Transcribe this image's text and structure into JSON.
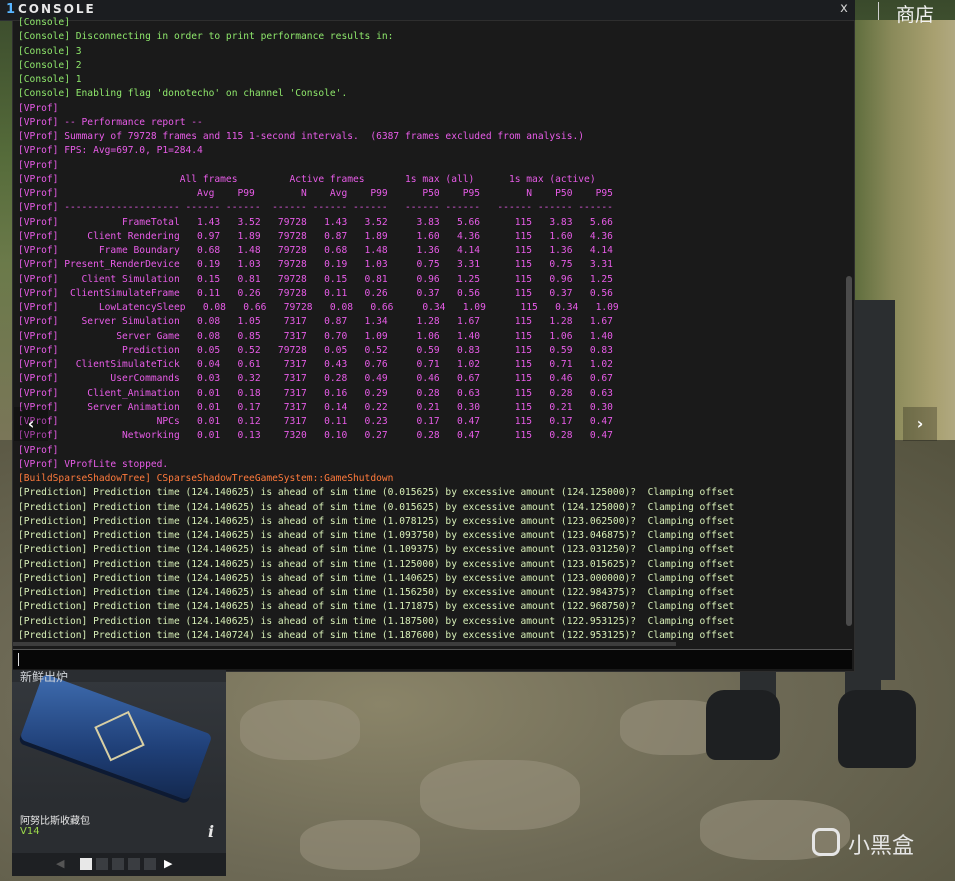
{
  "header": {
    "logo_glyph": "1",
    "title": "CONSOLE",
    "close_label": "x",
    "shop_label": "商店"
  },
  "colors": {
    "console": "#8fe86c",
    "vprof": "#e85ce8",
    "build": "#ff7a3c",
    "prediction": "#d8f0b8"
  },
  "console": {
    "lines": [
      {
        "kind": "console",
        "text": "[Console] "
      },
      {
        "kind": "console",
        "text": "[Console] Disconnecting in order to print performance results in:"
      },
      {
        "kind": "console",
        "text": "[Console] 3"
      },
      {
        "kind": "console",
        "text": "[Console] 2"
      },
      {
        "kind": "console",
        "text": "[Console] 1"
      },
      {
        "kind": "console",
        "text": "[Console] Enabling flag 'donotecho' on channel 'Console'."
      },
      {
        "kind": "vprof",
        "text": "[VProf]"
      },
      {
        "kind": "vprof",
        "text": "[VProf] -- Performance report --"
      },
      {
        "kind": "vprof",
        "text": "[VProf] Summary of 79728 frames and 115 1-second intervals.  (6387 frames excluded from analysis.)"
      },
      {
        "kind": "vprof",
        "text": "[VProf] FPS: Avg=697.0, P1=284.4"
      },
      {
        "kind": "vprof",
        "text": "[VProf]"
      },
      {
        "kind": "vprof",
        "text": "[VProf]                     All frames         Active frames       1s max (all)      1s max (active)"
      },
      {
        "kind": "vprof",
        "text": "[VProf]                        Avg    P99        N    Avg    P99      P50    P95        N    P50    P95"
      },
      {
        "kind": "vprof",
        "text": "[VProf] -------------------- ------ ------  ------ ------ ------   ------ ------   ------ ------ ------"
      },
      {
        "kind": "vprof",
        "text": "[VProf]           FrameTotal   1.43   3.52   79728   1.43   3.52     3.83   5.66      115   3.83   5.66"
      },
      {
        "kind": "vprof",
        "text": "[VProf]     Client Rendering   0.97   1.89   79728   0.87   1.89     1.60   4.36      115   1.60   4.36"
      },
      {
        "kind": "vprof",
        "text": "[VProf]       Frame Boundary   0.68   1.48   79728   0.68   1.48     1.36   4.14      115   1.36   4.14"
      },
      {
        "kind": "vprof",
        "text": "[VProf] Present_RenderDevice   0.19   1.03   79728   0.19   1.03     0.75   3.31      115   0.75   3.31"
      },
      {
        "kind": "vprof",
        "text": "[VProf]    Client Simulation   0.15   0.81   79728   0.15   0.81     0.96   1.25      115   0.96   1.25"
      },
      {
        "kind": "vprof",
        "text": "[VProf]  ClientSimulateFrame   0.11   0.26   79728   0.11   0.26     0.37   0.56      115   0.37   0.56"
      },
      {
        "kind": "vprof",
        "text": "[VProf]       LowLatencySleep   0.08   0.66   79728   0.08   0.66     0.34   1.09      115   0.34   1.09"
      },
      {
        "kind": "vprof",
        "text": "[VProf]    Server Simulation   0.08   1.05    7317   0.87   1.34     1.28   1.67      115   1.28   1.67"
      },
      {
        "kind": "vprof",
        "text": "[VProf]          Server Game   0.08   0.85    7317   0.70   1.09     1.06   1.40      115   1.06   1.40"
      },
      {
        "kind": "vprof",
        "text": "[VProf]           Prediction   0.05   0.52   79728   0.05   0.52     0.59   0.83      115   0.59   0.83"
      },
      {
        "kind": "vprof",
        "text": "[VProf]   ClientSimulateTick   0.04   0.61    7317   0.43   0.76     0.71   1.02      115   0.71   1.02"
      },
      {
        "kind": "vprof",
        "text": "[VProf]         UserCommands   0.03   0.32    7317   0.28   0.49     0.46   0.67      115   0.46   0.67"
      },
      {
        "kind": "vprof",
        "text": "[VProf]     Client_Animation   0.01   0.18    7317   0.16   0.29     0.28   0.63      115   0.28   0.63"
      },
      {
        "kind": "vprof",
        "text": "[VProf]     Server Animation   0.01   0.17    7317   0.14   0.22     0.21   0.30      115   0.21   0.30"
      },
      {
        "kind": "vprof",
        "text": "[VProf]                 NPCs   0.01   0.12    7317   0.11   0.23     0.17   0.47      115   0.17   0.47"
      },
      {
        "kind": "vprof",
        "text": "[VProf]           Networking   0.01   0.13    7320   0.10   0.27     0.28   0.47      115   0.28   0.47"
      },
      {
        "kind": "vprof",
        "text": "[VProf]"
      },
      {
        "kind": "vprof",
        "text": "[VProf] VProfLite stopped."
      },
      {
        "kind": "build",
        "text": "[BuildSparseShadowTree] CSparseShadowTreeGameSystem::GameShutdown"
      },
      {
        "kind": "pred",
        "text": "[Prediction] Prediction time (124.140625) is ahead of sim time (0.015625) by excessive amount (124.125000)?  Clamping offset"
      },
      {
        "kind": "pred",
        "text": "[Prediction] Prediction time (124.140625) is ahead of sim time (0.015625) by excessive amount (124.125000)?  Clamping offset"
      },
      {
        "kind": "pred",
        "text": "[Prediction] Prediction time (124.140625) is ahead of sim time (1.078125) by excessive amount (123.062500)?  Clamping offset"
      },
      {
        "kind": "pred",
        "text": "[Prediction] Prediction time (124.140625) is ahead of sim time (1.093750) by excessive amount (123.046875)?  Clamping offset"
      },
      {
        "kind": "pred",
        "text": "[Prediction] Prediction time (124.140625) is ahead of sim time (1.109375) by excessive amount (123.031250)?  Clamping offset"
      },
      {
        "kind": "pred",
        "text": "[Prediction] Prediction time (124.140625) is ahead of sim time (1.125000) by excessive amount (123.015625)?  Clamping offset"
      },
      {
        "kind": "pred",
        "text": "[Prediction] Prediction time (124.140625) is ahead of sim time (1.140625) by excessive amount (123.000000)?  Clamping offset"
      },
      {
        "kind": "pred",
        "text": "[Prediction] Prediction time (124.140625) is ahead of sim time (1.156250) by excessive amount (122.984375)?  Clamping offset"
      },
      {
        "kind": "pred",
        "text": "[Prediction] Prediction time (124.140625) is ahead of sim time (1.171875) by excessive amount (122.968750)?  Clamping offset"
      },
      {
        "kind": "pred",
        "text": "[Prediction] Prediction time (124.140625) is ahead of sim time (1.187500) by excessive amount (122.953125)?  Clamping offset"
      },
      {
        "kind": "pred",
        "text": "[Prediction] Prediction time (124.140724) is ahead of sim time (1.187600) by excessive amount (122.953125)?  Clamping offset"
      }
    ],
    "input_value": ""
  },
  "nav": {
    "prev_arrow": "‹",
    "next_arrow": "›"
  },
  "item_panel": {
    "header": "新鲜出炉",
    "name": "阿努比斯收藏包",
    "price": "V14",
    "info_glyph": "i",
    "pager_prev": "◀",
    "pager_next": "▶"
  },
  "watermark": {
    "text": "小黑盒"
  }
}
